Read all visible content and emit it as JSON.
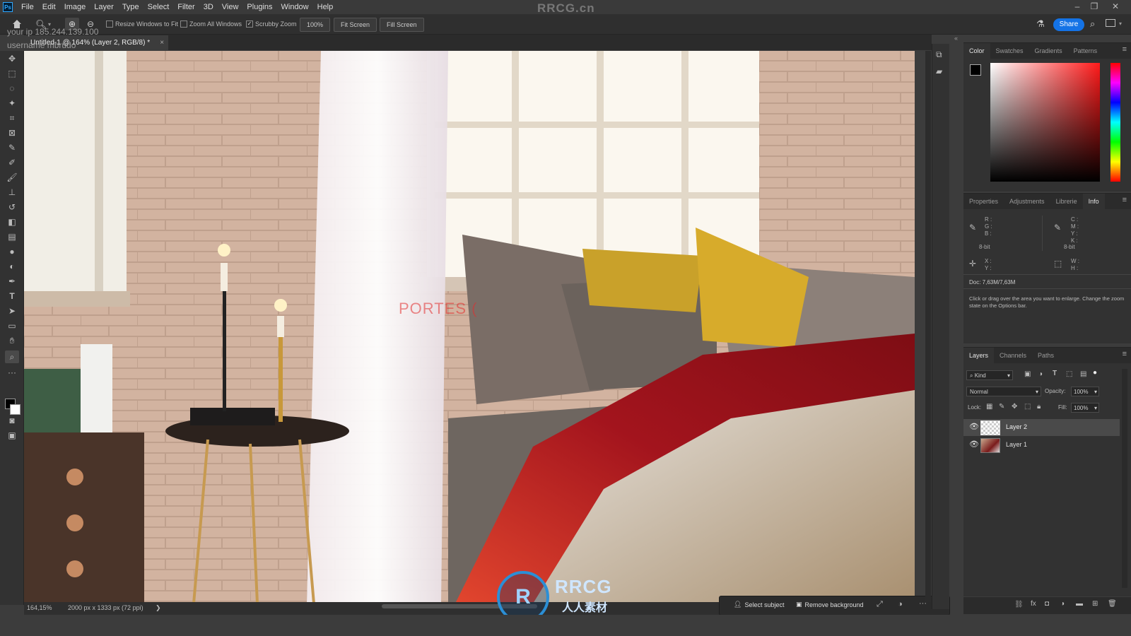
{
  "app": {
    "logo": "Ps",
    "watermark": "RRCG.cn"
  },
  "menu": [
    "File",
    "Edit",
    "Image",
    "Layer",
    "Type",
    "Select",
    "Filter",
    "3D",
    "View",
    "Plugins",
    "Window",
    "Help"
  ],
  "options_bar": {
    "resize_windows": "Resize Windows to Fit",
    "zoom_all": "Zoom All Windows",
    "scrubby_zoom": "Scrubby Zoom",
    "zoom_value": "100%",
    "fit_screen": "Fit Screen",
    "fill_screen": "Fill Screen",
    "share": "Share"
  },
  "overlay": {
    "ip": "your ip 185.244.139.100",
    "user": "username mbrudo"
  },
  "document": {
    "tab_title": "Untitled-1 @ 164% (Layer 2, RGB/8) *",
    "close": "×"
  },
  "canvas_watermark": "PORTES (",
  "status": {
    "zoom": "164,15%",
    "doc_size": "2000 px x 1333 px (72 ppi)",
    "arrow": "❯"
  },
  "context_bar": {
    "select_subject": "Select subject",
    "remove_background": "Remove background"
  },
  "color_panel": {
    "tabs": [
      "Color",
      "Swatches",
      "Gradients",
      "Patterns"
    ],
    "active": "Color"
  },
  "info_panel": {
    "tabs": [
      "Properties",
      "Adjustments",
      "Librerie",
      "Info"
    ],
    "active": "Info",
    "rgb_labels": [
      "R :",
      "G :",
      "B :"
    ],
    "cmyk_labels": [
      "C :",
      "M :",
      "Y :",
      "K :"
    ],
    "bitdepth_left": "8-bit",
    "bitdepth_right": "8-bit",
    "xy_labels": [
      "X :",
      "Y :"
    ],
    "wh_labels": [
      "W :",
      "H :"
    ],
    "doc": "Doc: 7,63M/7,63M",
    "hint": "Click or drag over the area you want to enlarge. Change the zoom state on the Options bar."
  },
  "layers_panel": {
    "tabs": [
      "Layers",
      "Channels",
      "Paths"
    ],
    "active": "Layers",
    "kind": "Kind",
    "blend_mode": "Normal",
    "opacity_label": "Opacity:",
    "opacity_value": "100%",
    "lock_label": "Lock:",
    "fill_label": "Fill:",
    "fill_value": "100%",
    "layers": [
      {
        "name": "Layer 2",
        "selected": true
      },
      {
        "name": "Layer 1",
        "selected": false
      }
    ]
  },
  "bottom_logo": {
    "main": "RRCG",
    "sub": "人人素材"
  },
  "colors": {
    "accent": "#1473e6",
    "foreground": "#000000",
    "background": "#ffffff"
  }
}
